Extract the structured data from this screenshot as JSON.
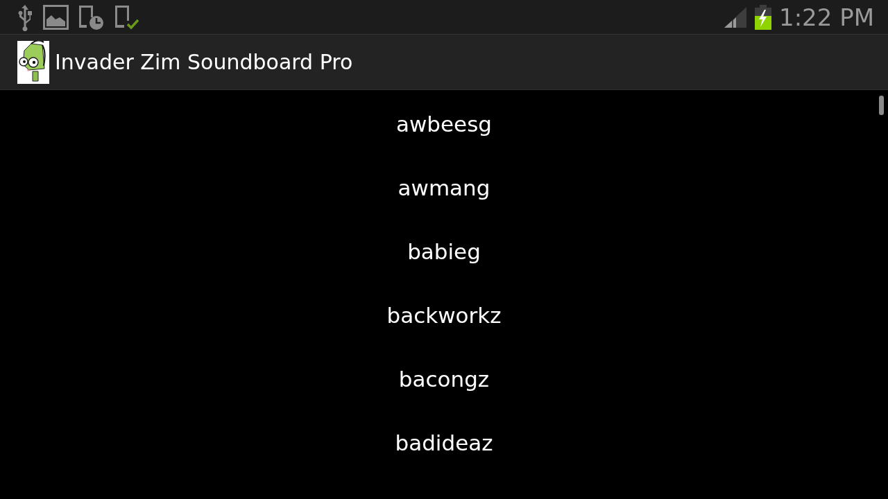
{
  "status_bar": {
    "time": "1:22 PM",
    "battery_charging": true
  },
  "action_bar": {
    "title": "Invader Zim Soundboard Pro"
  },
  "sounds": [
    {
      "label": "awbeesg"
    },
    {
      "label": "awmang"
    },
    {
      "label": "babieg"
    },
    {
      "label": "backworkz"
    },
    {
      "label": "bacongz"
    },
    {
      "label": "badideaz"
    }
  ]
}
